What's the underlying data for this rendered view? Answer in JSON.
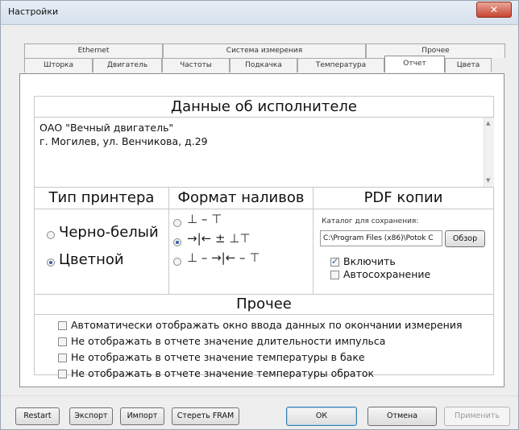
{
  "window": {
    "title": "Настройки",
    "close_label": "✕"
  },
  "tabs_top": [
    "Ethernet",
    "Система измерения",
    "Прочее"
  ],
  "tabs_bottom": [
    "Шторка",
    "Двигатель",
    "Частоты",
    "Подкачка",
    "Температура",
    "Отчет",
    "Цвета"
  ],
  "active_tab": "Отчет",
  "executor": {
    "header": "Данные об исполнителе",
    "text": "ОАО \"Вечный двигатель\"\nг. Могилев, ул. Венчикова, д.29"
  },
  "printer": {
    "header": "Тип принтера",
    "options": [
      {
        "label": "Черно-белый",
        "selected": false
      },
      {
        "label": "Цветной",
        "selected": true
      }
    ]
  },
  "pour_format": {
    "header": "Формат наливов",
    "options": [
      {
        "symbols": "⊥ – ⊤",
        "selected": false
      },
      {
        "symbols": "→|← ± ⊥⊤",
        "selected": true
      },
      {
        "symbols": "⊥ – →|← – ⊤",
        "selected": false
      }
    ]
  },
  "pdf": {
    "header": "PDF копии",
    "folder_label": "Каталог для сохранения:",
    "folder_path": "C:\\Program Files (x86)\\Potok C",
    "browse_label": "Обзор",
    "enable_label": "Включить",
    "enable_checked": true,
    "autosave_label": "Автосохранение",
    "autosave_checked": false
  },
  "other": {
    "header": "Прочее",
    "options": [
      {
        "label": "Автоматически отображать окно ввода данных по окончании измерения",
        "checked": false
      },
      {
        "label": "Не отображать в отчете значение длительности импульса",
        "checked": false
      },
      {
        "label": "Не отображать в отчете значение температуры в баке",
        "checked": false
      },
      {
        "label": "Не отображать в отчете значение температуры обраток",
        "checked": false
      }
    ]
  },
  "buttons": {
    "restart": "Restart",
    "export": "Экспорт",
    "import": "Импорт",
    "erase_fram": "Стереть FRAM",
    "ok": "ОК",
    "cancel": "Отмена",
    "apply": "Применить"
  }
}
